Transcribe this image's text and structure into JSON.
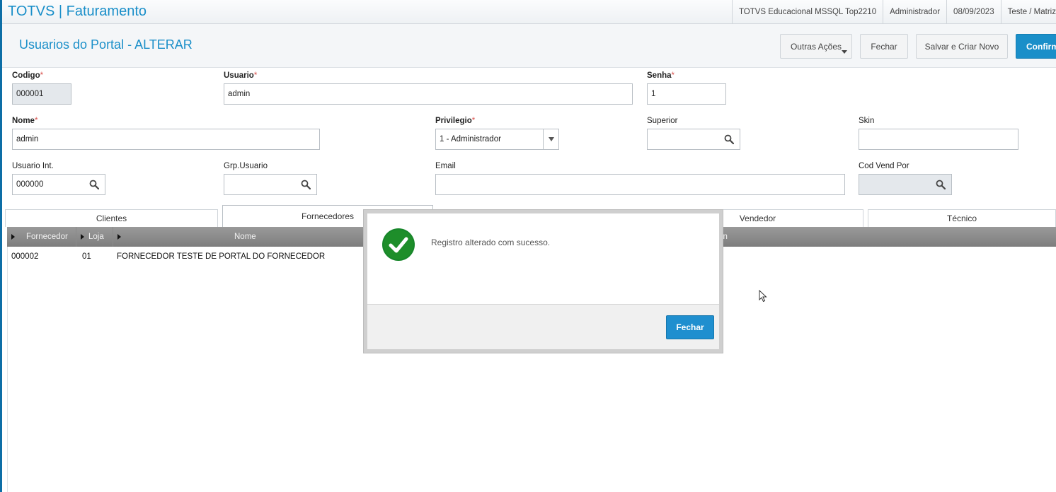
{
  "topbar": {
    "app_title": "TOTVS | Faturamento",
    "environment": "TOTVS Educacional MSSQL Top2210",
    "user": "Administrador",
    "date": "08/09/2023",
    "branch": "Teste / Matriz"
  },
  "header": {
    "page_title": "Usuarios do Portal - ALTERAR",
    "outras_acoes_label": "Outras Ações",
    "fechar_label": "Fechar",
    "salvar_label": "Salvar e Criar Novo",
    "confirmar_label": "Confirmar"
  },
  "form": {
    "codigo": {
      "label": "Codigo",
      "value": "000001"
    },
    "usuario": {
      "label": "Usuario",
      "value": "admin"
    },
    "senha": {
      "label": "Senha",
      "value": "1"
    },
    "nome": {
      "label": "Nome",
      "value": "admin"
    },
    "privilegio": {
      "label": "Privilegio",
      "value": "1 - Administrador"
    },
    "superior": {
      "label": "Superior",
      "value": ""
    },
    "skin": {
      "label": "Skin",
      "value": ""
    },
    "usuario_int": {
      "label": "Usuario Int.",
      "value": "000000"
    },
    "grp_usuario": {
      "label": "Grp.Usuario",
      "value": ""
    },
    "email": {
      "label": "Email",
      "value": ""
    },
    "cod_vend_por": {
      "label": "Cod Vend Por",
      "value": ""
    },
    "required_marker": "*"
  },
  "tabs": [
    {
      "label": "Clientes"
    },
    {
      "label": "Fornecedores"
    },
    {
      "label": ""
    },
    {
      "label": "Vendedor"
    },
    {
      "label": "Técnico"
    }
  ],
  "grid": {
    "columns": [
      "Fornecedor",
      "Loja",
      "Nome",
      "in"
    ],
    "rows": [
      {
        "fornecedor": "000002",
        "loja": "01",
        "nome": "FORNECEDOR TESTE DE PORTAL DO FORNECEDOR"
      }
    ]
  },
  "modal": {
    "message": "Registro alterado com sucesso.",
    "button_label": "Fechar"
  },
  "colors": {
    "accent": "#1a8fc9",
    "success": "#1e8e2a",
    "required": "#d9534f"
  }
}
